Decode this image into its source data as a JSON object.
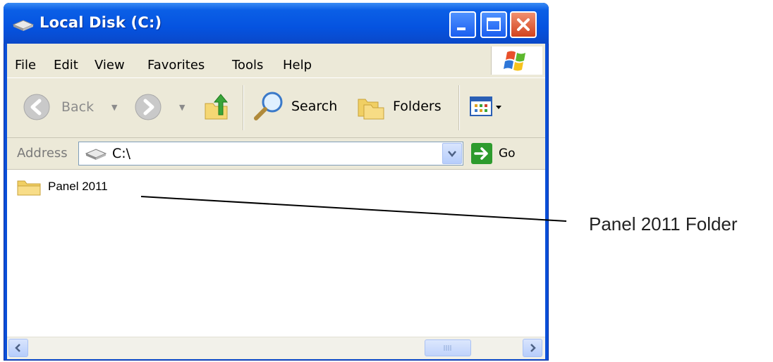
{
  "window": {
    "title": "Local Disk (C:)",
    "controls": {
      "minimize": "minimize",
      "maximize": "maximize",
      "close": "close"
    }
  },
  "menu": {
    "items": [
      "File",
      "Edit",
      "View",
      "Favorites",
      "Tools",
      "Help"
    ]
  },
  "toolbar": {
    "back_label": "Back",
    "search_label": "Search",
    "folders_label": "Folders"
  },
  "address": {
    "label": "Address",
    "value": "C:\\",
    "go_label": "Go"
  },
  "content": {
    "items": [
      {
        "name": "Panel 2011",
        "type": "folder"
      }
    ]
  },
  "annotation": {
    "label": "Panel 2011 Folder"
  },
  "colors": {
    "titlebar": "#0553e0",
    "frame": "#ece9d8",
    "close_button": "#d2431e",
    "go_button": "#2d9b2d"
  },
  "icons": {
    "title": "drive-icon",
    "back": "back-arrow-icon",
    "forward": "forward-arrow-icon",
    "up": "folder-up-icon",
    "search": "magnifier-icon",
    "folders": "folders-icon",
    "views": "views-icon",
    "go": "go-arrow-icon",
    "folder": "folder-icon"
  }
}
